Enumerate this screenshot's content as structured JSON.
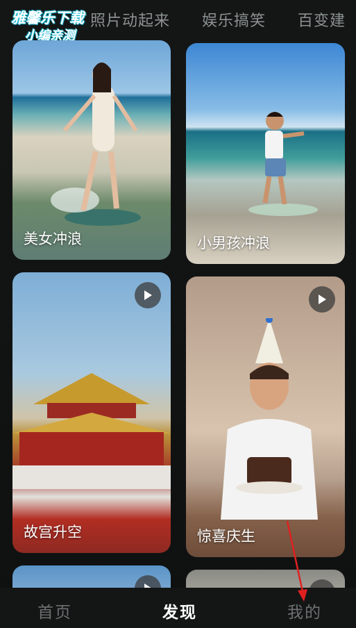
{
  "watermark": {
    "line1": "雅馨乐下载",
    "line2": "小编亲测"
  },
  "top_tabs": [
    {
      "label": "照片动起来"
    },
    {
      "label": "娱乐搞笑"
    },
    {
      "label": "百变建"
    }
  ],
  "cards": [
    {
      "label": "美女冲浪",
      "has_play": false
    },
    {
      "label": "小男孩冲浪",
      "has_play": false
    },
    {
      "label": "故宫升空",
      "has_play": true
    },
    {
      "label": "惊喜庆生",
      "has_play": true
    },
    {
      "label": "",
      "has_play": true
    },
    {
      "label": "",
      "has_play": true
    }
  ],
  "bottom_nav": [
    {
      "label": "首页",
      "active": false
    },
    {
      "label": "发现",
      "active": true
    },
    {
      "label": "我的",
      "active": false
    }
  ],
  "colors": {
    "background": "#101212",
    "active_nav": "#ffffff",
    "inactive_nav": "#6c7070",
    "annotation_arrow": "#e02020"
  }
}
